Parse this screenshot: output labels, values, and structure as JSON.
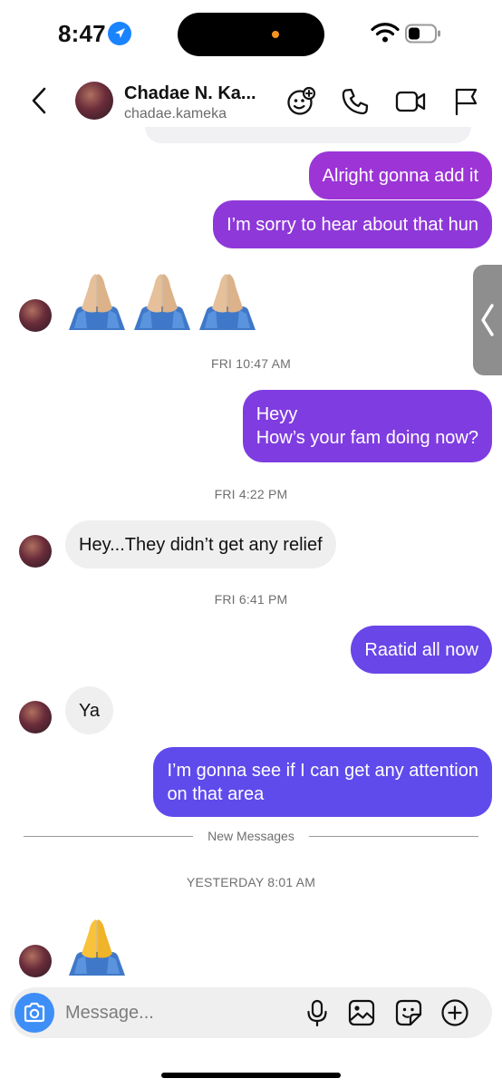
{
  "status_bar": {
    "time": "8:47",
    "icons": [
      "location-arrow-icon",
      "dynamic-island",
      "wifi-icon",
      "battery-icon"
    ]
  },
  "header": {
    "contact_name": "Chadae N. Ka...",
    "contact_handle": "chadae.kameka",
    "icons": [
      "back-chevron-icon",
      "effects-icon",
      "phone-icon",
      "video-camera-icon",
      "flag-icon"
    ]
  },
  "messages": {
    "out_1": "Alright gonna add it",
    "out_2": "I’m sorry to hear about that hun",
    "emoji_reaction_1": "🙏🏼🙏🏼🙏🏼",
    "time_1": "FRI 10:47 AM",
    "out_3_line1": "Heyy",
    "out_3_line2": "How’s your fam doing now?",
    "time_2": "FRI 4:22 PM",
    "in_1": "Hey...They didn’t get any relief",
    "time_3": "FRI 6:41 PM",
    "out_4": "Raatid all now",
    "in_2": "Ya",
    "out_5_line1": "I’m gonna see if I can get any attention",
    "out_5_line2": "on that area",
    "new_messages_label": "New Messages",
    "time_4": "YESTERDAY 8:01 AM",
    "emoji_reaction_2": "🙏"
  },
  "composer": {
    "placeholder": "Message...",
    "icons": [
      "camera-icon",
      "microphone-icon",
      "gallery-icon",
      "sticker-icon",
      "plus-icon"
    ]
  },
  "colors": {
    "bubble_gradient_top": "#9c34d6",
    "bubble_gradient_bottom": "#5f4aec",
    "incoming_bubble": "#efefef",
    "camera_button": "#3e8ef7",
    "timestamp_text": "#6f6f6f"
  }
}
